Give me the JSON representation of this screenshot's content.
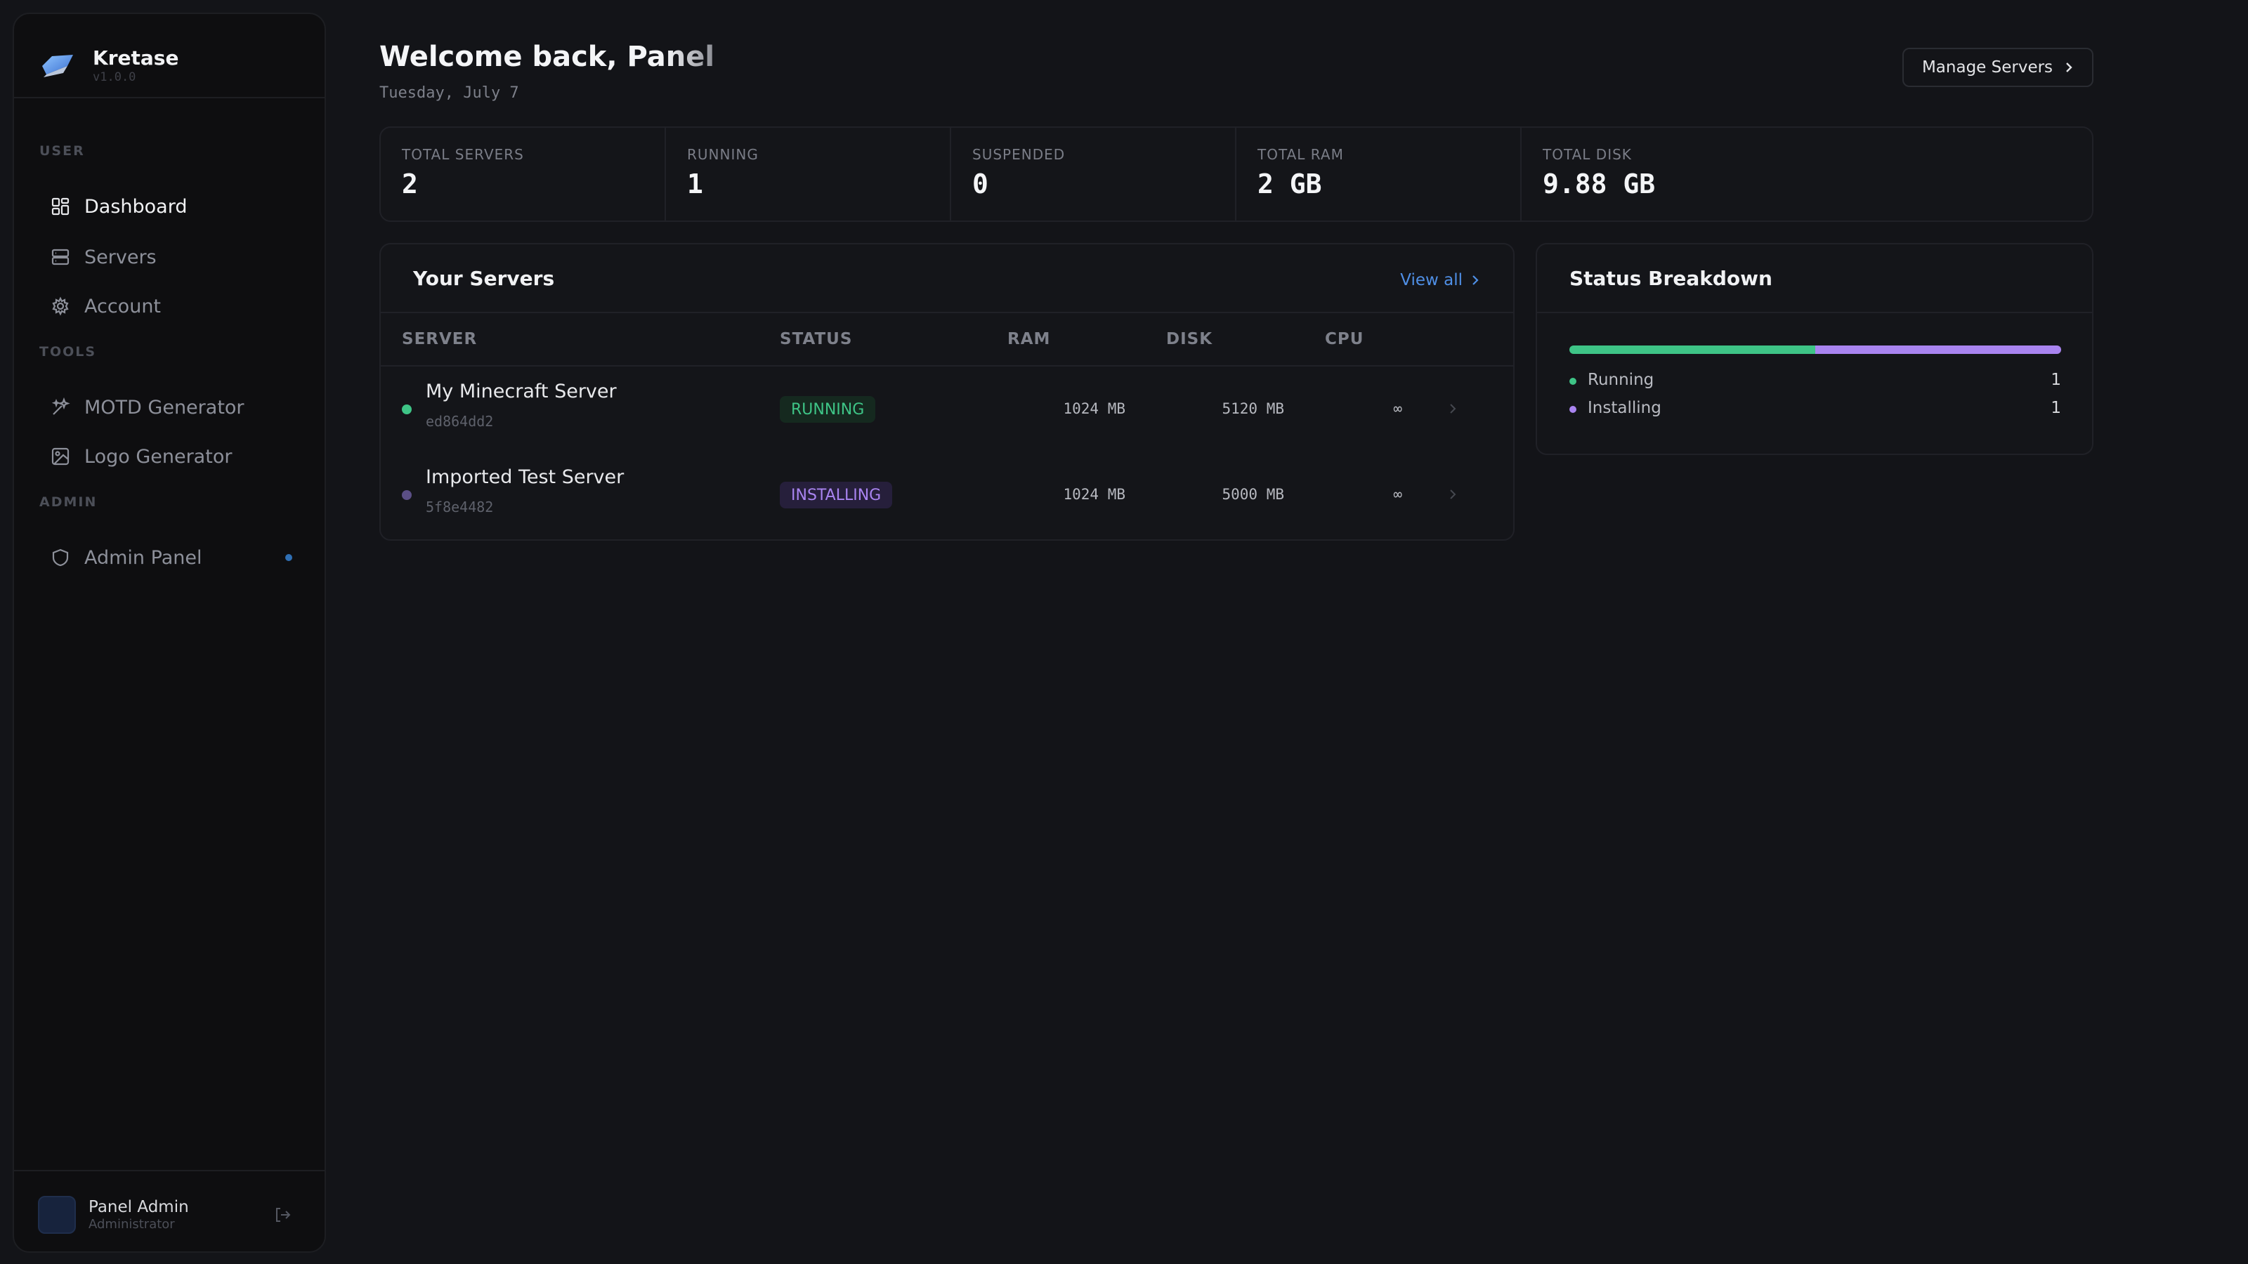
{
  "sidebar": {
    "brand": {
      "name": "Kretase",
      "version": "v1.0.0"
    },
    "sections": [
      {
        "label": "USER",
        "items": [
          {
            "label": "Dashboard",
            "icon": "dashboard-icon",
            "active": true
          },
          {
            "label": "Servers",
            "icon": "servers-icon"
          },
          {
            "label": "Account",
            "icon": "gear-icon"
          }
        ]
      },
      {
        "label": "TOOLS",
        "items": [
          {
            "label": "MOTD Generator",
            "icon": "sparkles-icon"
          },
          {
            "label": "Logo Generator",
            "icon": "image-icon"
          }
        ]
      },
      {
        "label": "ADMIN",
        "items": [
          {
            "label": "Admin Panel",
            "icon": "shield-icon"
          }
        ]
      }
    ],
    "user": {
      "name": "Panel Admin",
      "role": "Administrator"
    }
  },
  "header": {
    "title_main": "Welcome back, Pa",
    "title_fade": "nel",
    "date": "Tuesday, July 7",
    "manage_button": "Manage Servers"
  },
  "stats": [
    {
      "label": "TOTAL SERVERS",
      "value": "2"
    },
    {
      "label": "RUNNING",
      "value": "1"
    },
    {
      "label": "SUSPENDED",
      "value": "0"
    },
    {
      "label": "TOTAL RAM",
      "value": "2 GB"
    },
    {
      "label": "TOTAL DISK",
      "value": "9.88 GB"
    }
  ],
  "servers_card": {
    "title": "Your Servers",
    "view_all": "View all",
    "columns": [
      "SERVER",
      "STATUS",
      "RAM",
      "DISK",
      "CPU"
    ],
    "rows": [
      {
        "name": "My Minecraft Server",
        "id": "ed864dd2",
        "status": "RUNNING",
        "ram": "1024 MB",
        "disk": "5120 MB",
        "cpu": "∞",
        "dot_color": "#3ec486"
      },
      {
        "name": "Imported Test Server",
        "id": "5f8e4482",
        "status": "INSTALLING",
        "ram": "1024 MB",
        "disk": "5000 MB",
        "cpu": "∞",
        "dot_color": "#5b4f86"
      }
    ]
  },
  "breakdown": {
    "title": "Status Breakdown",
    "items": [
      {
        "label": "Running",
        "value": "1",
        "color": "#3ec486"
      },
      {
        "label": "Installing",
        "value": "1",
        "color": "#a984f0"
      }
    ]
  },
  "colors": {
    "accent": "#4f8fe6",
    "running": "#3ec486",
    "installing": "#a984f0"
  }
}
